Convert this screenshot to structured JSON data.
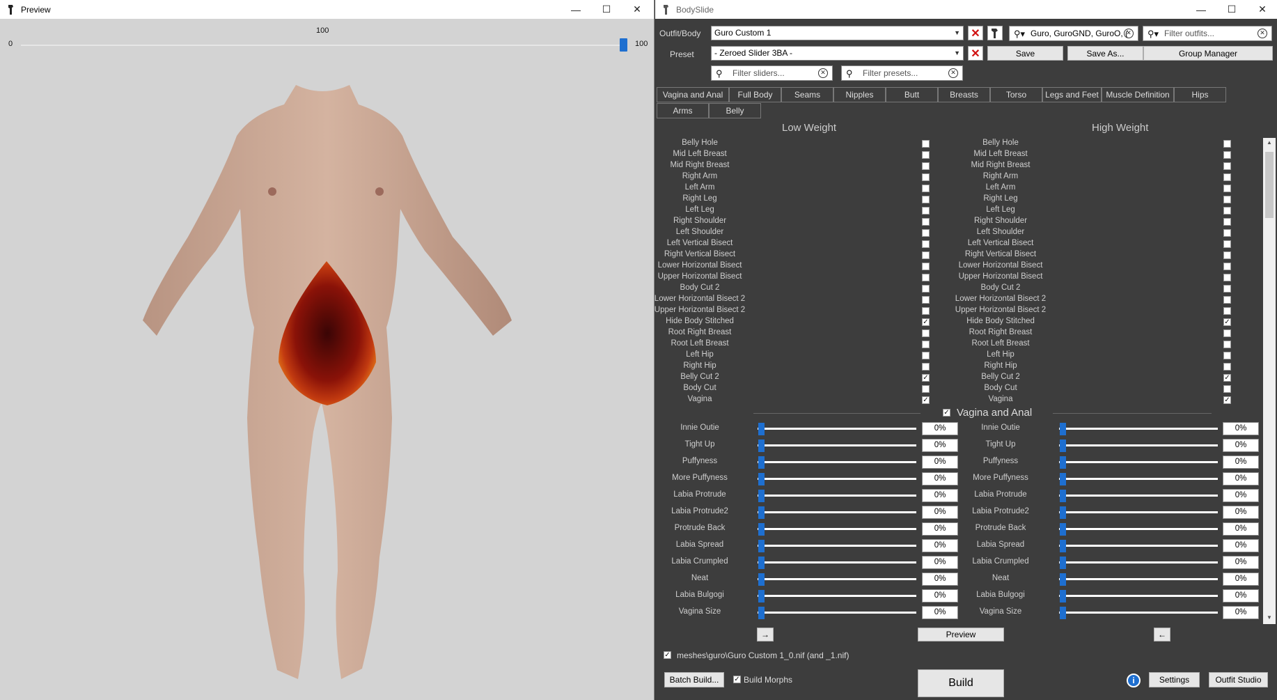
{
  "preview": {
    "title": "Preview",
    "slider": {
      "min_label": "0",
      "max_label": "100",
      "value_label": "100",
      "value": 100
    }
  },
  "bodyslide": {
    "title": "BodySlide",
    "outfit_label": "Outfit/Body",
    "outfit_value": "Guro Custom 1",
    "preset_label": "Preset",
    "preset_value": "- Zeroed Slider 3BA -",
    "outfit_filter_value": "Guro, GuroGND, GuroO, (",
    "outfit_filter_placeholder": "Filter outfits...",
    "slider_filter_placeholder": "Filter sliders...",
    "preset_filter_placeholder": "Filter presets...",
    "save_label": "Save",
    "save_as_label": "Save As...",
    "group_manager_label": "Group Manager",
    "tabs": [
      "Vagina and Anal",
      "Full Body",
      "Seams",
      "Nipples",
      "Butt",
      "Breasts",
      "Torso",
      "Legs and Feet",
      "Muscle Definition",
      "Hips",
      "Arms",
      "Belly"
    ],
    "low_weight_header": "Low Weight",
    "high_weight_header": "High Weight",
    "zap_items": [
      {
        "label": "Belly Hole",
        "checked": false
      },
      {
        "label": "Mid Left Breast",
        "checked": false
      },
      {
        "label": "Mid Right Breast",
        "checked": false
      },
      {
        "label": "Right Arm",
        "checked": false
      },
      {
        "label": "Left Arm",
        "checked": false
      },
      {
        "label": "Right Leg",
        "checked": false
      },
      {
        "label": "Left Leg",
        "checked": false
      },
      {
        "label": "Right Shoulder",
        "checked": false
      },
      {
        "label": "Left Shoulder",
        "checked": false
      },
      {
        "label": "Left Vertical Bisect",
        "checked": false
      },
      {
        "label": "Right Vertical Bisect",
        "checked": false
      },
      {
        "label": "Lower Horizontal Bisect",
        "checked": false
      },
      {
        "label": "Upper Horizontal Bisect",
        "checked": false
      },
      {
        "label": "Body Cut 2",
        "checked": false
      },
      {
        "label": "Lower Horizontal Bisect 2",
        "checked": false
      },
      {
        "label": "Upper Horizontal Bisect 2",
        "checked": false
      },
      {
        "label": "Hide Body Stitched",
        "checked": true
      },
      {
        "label": "Root Right Breast",
        "checked": false
      },
      {
        "label": "Root Left Breast",
        "checked": false
      },
      {
        "label": "Left Hip",
        "checked": false
      },
      {
        "label": "Right Hip",
        "checked": false
      },
      {
        "label": "Belly Cut 2",
        "checked": true
      },
      {
        "label": "Body Cut",
        "checked": false
      },
      {
        "label": "Vagina",
        "checked": true
      }
    ],
    "group_header": "Vagina and Anal",
    "group_checked": true,
    "sliders": [
      {
        "label": "Innie Outie",
        "low": "0%",
        "high": "0%"
      },
      {
        "label": "Tight Up",
        "low": "0%",
        "high": "0%"
      },
      {
        "label": "Puffyness",
        "low": "0%",
        "high": "0%"
      },
      {
        "label": "More Puffyness",
        "low": "0%",
        "high": "0%"
      },
      {
        "label": "Labia Protrude",
        "low": "0%",
        "high": "0%"
      },
      {
        "label": "Labia Protrude2",
        "low": "0%",
        "high": "0%"
      },
      {
        "label": "Protrude Back",
        "low": "0%",
        "high": "0%"
      },
      {
        "label": "Labia Spread",
        "low": "0%",
        "high": "0%"
      },
      {
        "label": "Labia Crumpled",
        "low": "0%",
        "high": "0%"
      },
      {
        "label": "Neat",
        "low": "0%",
        "high": "0%"
      },
      {
        "label": "Labia Bulgogi",
        "low": "0%",
        "high": "0%"
      },
      {
        "label": "Vagina Size",
        "low": "0%",
        "high": "0%"
      }
    ],
    "arrow_right": "→",
    "arrow_left": "←",
    "preview_button": "Preview",
    "output_path": "meshes\\guro\\Guro Custom 1_0.nif (and _1.nif)",
    "output_checked": true,
    "batch_build_label": "Batch Build...",
    "build_morphs_label": "Build Morphs",
    "build_morphs_checked": true,
    "build_label": "Build",
    "settings_label": "Settings",
    "outfit_studio_label": "Outfit Studio",
    "colors": {
      "accent": "#1e6fd0",
      "panel_bg": "#3d3d3d",
      "danger": "#d01010"
    }
  }
}
